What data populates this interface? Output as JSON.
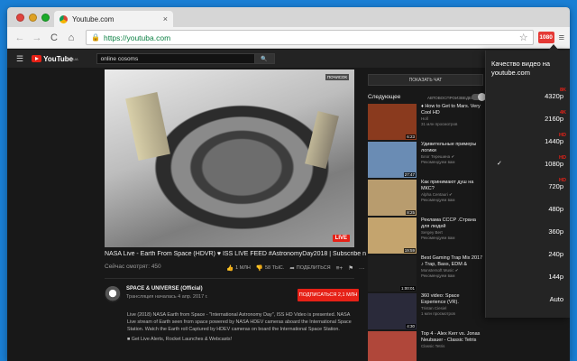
{
  "browser": {
    "tab_title": "Youtube.com",
    "tab_close": "×",
    "url": "https://youtuba.com",
    "lock_icon": "🔒",
    "ext_badge": "1080",
    "nav": {
      "back": "←",
      "forward": "→",
      "reload": "C",
      "home": "⌂",
      "star": "☆",
      "menu": "≡"
    },
    "traffic_lights": [
      "#e0443e",
      "#dea123",
      "#1aab29"
    ]
  },
  "youtube": {
    "logo_text": "YouTube",
    "logo_sup": "UA",
    "search_value": "online cosoms",
    "search_icon": "🔍"
  },
  "video": {
    "skip_label": "ПОЧИСОК",
    "live_badge": "LIVE",
    "title": "NASA Live - Earth From Space (HDVR) ♥ ISS LIVE FEED #AstronomyDay2018 | Subscribe now!",
    "views": "Сейчас смотрят: 450",
    "likes": "1 МЛН",
    "dislikes": "58 ТЫС.",
    "share": "ПОДЕЛИТЬСЯ",
    "channel": "SPACE & UNIVERSE (Official)",
    "published": "Трансляция началась 4 апр. 2017 г.",
    "subscribe": "ПОДПИСАТЬСЯ  2,1 МЛН",
    "description": [
      "Live (2018) NASA Earth from Space - \"International Astronomy Day\", ISS HD Video is presented. NASA Live stream of Earth seen from space powered by NASA HDEV cameras aboard the International Space Station. Watch the Earth roll Captured by HDEV cameras on board the International Space Station.",
      "■ Get Live Alerts, Rocket Launches & Webcasts!"
    ]
  },
  "sidebar": {
    "chat_button": "ПОКАЗАТЬ ЧАТ",
    "next_label": "Следующее",
    "autoplay_label": "АВТОВОСПРОИЗВЕДЕНИЕ",
    "items": [
      {
        "title": "♦ How to Get to Mars. Very Cool HD",
        "channel": "Holl",
        "views": "31 млн просмотров",
        "duration": "6:23",
        "color": "#8a3a1e"
      },
      {
        "title": "Удивительные примеры логики",
        "channel": "Блог Терешина ✔",
        "views": "Рекомендуем вам",
        "duration": "27:47",
        "color": "#6a8cb4"
      },
      {
        "title": "Как принимают душ на МКС?",
        "channel": "Alpha Centauri ✔",
        "views": "Рекомендуем вам",
        "duration": "8:25",
        "color": "#b89c6e"
      },
      {
        "title": "Реклама СССР .Страна для людей",
        "channel": "Sergey Bert",
        "views": "Рекомендуем вам",
        "duration": "19:59",
        "color": "#c4a46e"
      },
      {
        "title": "Best Gaming Trap Mix 2017 ♪ Trap, Bass, EDM & Dubstep",
        "channel": "Monstersoft Music ✔",
        "views": "Рекомендуем вам",
        "duration": "1:00:01",
        "color": "#1e1e1e"
      },
      {
        "title": "360 video: Space Experience (VR).",
        "channel": "Tristan Ciesiel",
        "views": "1 млн просмотров",
        "duration": "4:30",
        "color": "#2a2a3a"
      },
      {
        "title": "Top 4 - Alex Kerr vs. Jonas Neubauer - Classic Tetris World",
        "channel": "Classic Tetris",
        "views": "",
        "duration": "",
        "color": "#b0473a"
      }
    ]
  },
  "quality": {
    "title": "Качество видео на youtube.com",
    "check_mark": "✓",
    "options": [
      {
        "label": "4320p",
        "badge": "8K",
        "selected": false
      },
      {
        "label": "2160p",
        "badge": "4K",
        "selected": false
      },
      {
        "label": "1440p",
        "badge": "HD",
        "selected": false
      },
      {
        "label": "1080p",
        "badge": "HD",
        "selected": true
      },
      {
        "label": "720p",
        "badge": "HD",
        "selected": false
      },
      {
        "label": "480p",
        "badge": "",
        "selected": false
      },
      {
        "label": "360p",
        "badge": "",
        "selected": false
      },
      {
        "label": "240p",
        "badge": "",
        "selected": false
      },
      {
        "label": "144p",
        "badge": "",
        "selected": false
      },
      {
        "label": "Auto",
        "badge": "",
        "selected": false
      }
    ]
  }
}
